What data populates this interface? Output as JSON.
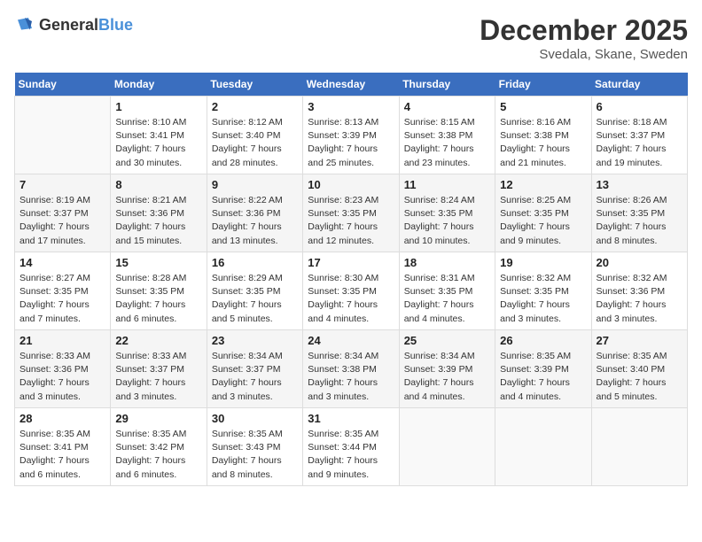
{
  "header": {
    "logo": {
      "general": "General",
      "blue": "Blue"
    },
    "title": "December 2025",
    "location": "Svedala, Skane, Sweden"
  },
  "calendar": {
    "days_of_week": [
      "Sunday",
      "Monday",
      "Tuesday",
      "Wednesday",
      "Thursday",
      "Friday",
      "Saturday"
    ],
    "weeks": [
      [
        {
          "day": "",
          "info": ""
        },
        {
          "day": "1",
          "info": "Sunrise: 8:10 AM\nSunset: 3:41 PM\nDaylight: 7 hours\nand 30 minutes."
        },
        {
          "day": "2",
          "info": "Sunrise: 8:12 AM\nSunset: 3:40 PM\nDaylight: 7 hours\nand 28 minutes."
        },
        {
          "day": "3",
          "info": "Sunrise: 8:13 AM\nSunset: 3:39 PM\nDaylight: 7 hours\nand 25 minutes."
        },
        {
          "day": "4",
          "info": "Sunrise: 8:15 AM\nSunset: 3:38 PM\nDaylight: 7 hours\nand 23 minutes."
        },
        {
          "day": "5",
          "info": "Sunrise: 8:16 AM\nSunset: 3:38 PM\nDaylight: 7 hours\nand 21 minutes."
        },
        {
          "day": "6",
          "info": "Sunrise: 8:18 AM\nSunset: 3:37 PM\nDaylight: 7 hours\nand 19 minutes."
        }
      ],
      [
        {
          "day": "7",
          "info": "Sunrise: 8:19 AM\nSunset: 3:37 PM\nDaylight: 7 hours\nand 17 minutes."
        },
        {
          "day": "8",
          "info": "Sunrise: 8:21 AM\nSunset: 3:36 PM\nDaylight: 7 hours\nand 15 minutes."
        },
        {
          "day": "9",
          "info": "Sunrise: 8:22 AM\nSunset: 3:36 PM\nDaylight: 7 hours\nand 13 minutes."
        },
        {
          "day": "10",
          "info": "Sunrise: 8:23 AM\nSunset: 3:35 PM\nDaylight: 7 hours\nand 12 minutes."
        },
        {
          "day": "11",
          "info": "Sunrise: 8:24 AM\nSunset: 3:35 PM\nDaylight: 7 hours\nand 10 minutes."
        },
        {
          "day": "12",
          "info": "Sunrise: 8:25 AM\nSunset: 3:35 PM\nDaylight: 7 hours\nand 9 minutes."
        },
        {
          "day": "13",
          "info": "Sunrise: 8:26 AM\nSunset: 3:35 PM\nDaylight: 7 hours\nand 8 minutes."
        }
      ],
      [
        {
          "day": "14",
          "info": "Sunrise: 8:27 AM\nSunset: 3:35 PM\nDaylight: 7 hours\nand 7 minutes."
        },
        {
          "day": "15",
          "info": "Sunrise: 8:28 AM\nSunset: 3:35 PM\nDaylight: 7 hours\nand 6 minutes."
        },
        {
          "day": "16",
          "info": "Sunrise: 8:29 AM\nSunset: 3:35 PM\nDaylight: 7 hours\nand 5 minutes."
        },
        {
          "day": "17",
          "info": "Sunrise: 8:30 AM\nSunset: 3:35 PM\nDaylight: 7 hours\nand 4 minutes."
        },
        {
          "day": "18",
          "info": "Sunrise: 8:31 AM\nSunset: 3:35 PM\nDaylight: 7 hours\nand 4 minutes."
        },
        {
          "day": "19",
          "info": "Sunrise: 8:32 AM\nSunset: 3:35 PM\nDaylight: 7 hours\nand 3 minutes."
        },
        {
          "day": "20",
          "info": "Sunrise: 8:32 AM\nSunset: 3:36 PM\nDaylight: 7 hours\nand 3 minutes."
        }
      ],
      [
        {
          "day": "21",
          "info": "Sunrise: 8:33 AM\nSunset: 3:36 PM\nDaylight: 7 hours\nand 3 minutes."
        },
        {
          "day": "22",
          "info": "Sunrise: 8:33 AM\nSunset: 3:37 PM\nDaylight: 7 hours\nand 3 minutes."
        },
        {
          "day": "23",
          "info": "Sunrise: 8:34 AM\nSunset: 3:37 PM\nDaylight: 7 hours\nand 3 minutes."
        },
        {
          "day": "24",
          "info": "Sunrise: 8:34 AM\nSunset: 3:38 PM\nDaylight: 7 hours\nand 3 minutes."
        },
        {
          "day": "25",
          "info": "Sunrise: 8:34 AM\nSunset: 3:39 PM\nDaylight: 7 hours\nand 4 minutes."
        },
        {
          "day": "26",
          "info": "Sunrise: 8:35 AM\nSunset: 3:39 PM\nDaylight: 7 hours\nand 4 minutes."
        },
        {
          "day": "27",
          "info": "Sunrise: 8:35 AM\nSunset: 3:40 PM\nDaylight: 7 hours\nand 5 minutes."
        }
      ],
      [
        {
          "day": "28",
          "info": "Sunrise: 8:35 AM\nSunset: 3:41 PM\nDaylight: 7 hours\nand 6 minutes."
        },
        {
          "day": "29",
          "info": "Sunrise: 8:35 AM\nSunset: 3:42 PM\nDaylight: 7 hours\nand 6 minutes."
        },
        {
          "day": "30",
          "info": "Sunrise: 8:35 AM\nSunset: 3:43 PM\nDaylight: 7 hours\nand 8 minutes."
        },
        {
          "day": "31",
          "info": "Sunrise: 8:35 AM\nSunset: 3:44 PM\nDaylight: 7 hours\nand 9 minutes."
        },
        {
          "day": "",
          "info": ""
        },
        {
          "day": "",
          "info": ""
        },
        {
          "day": "",
          "info": ""
        }
      ]
    ]
  }
}
